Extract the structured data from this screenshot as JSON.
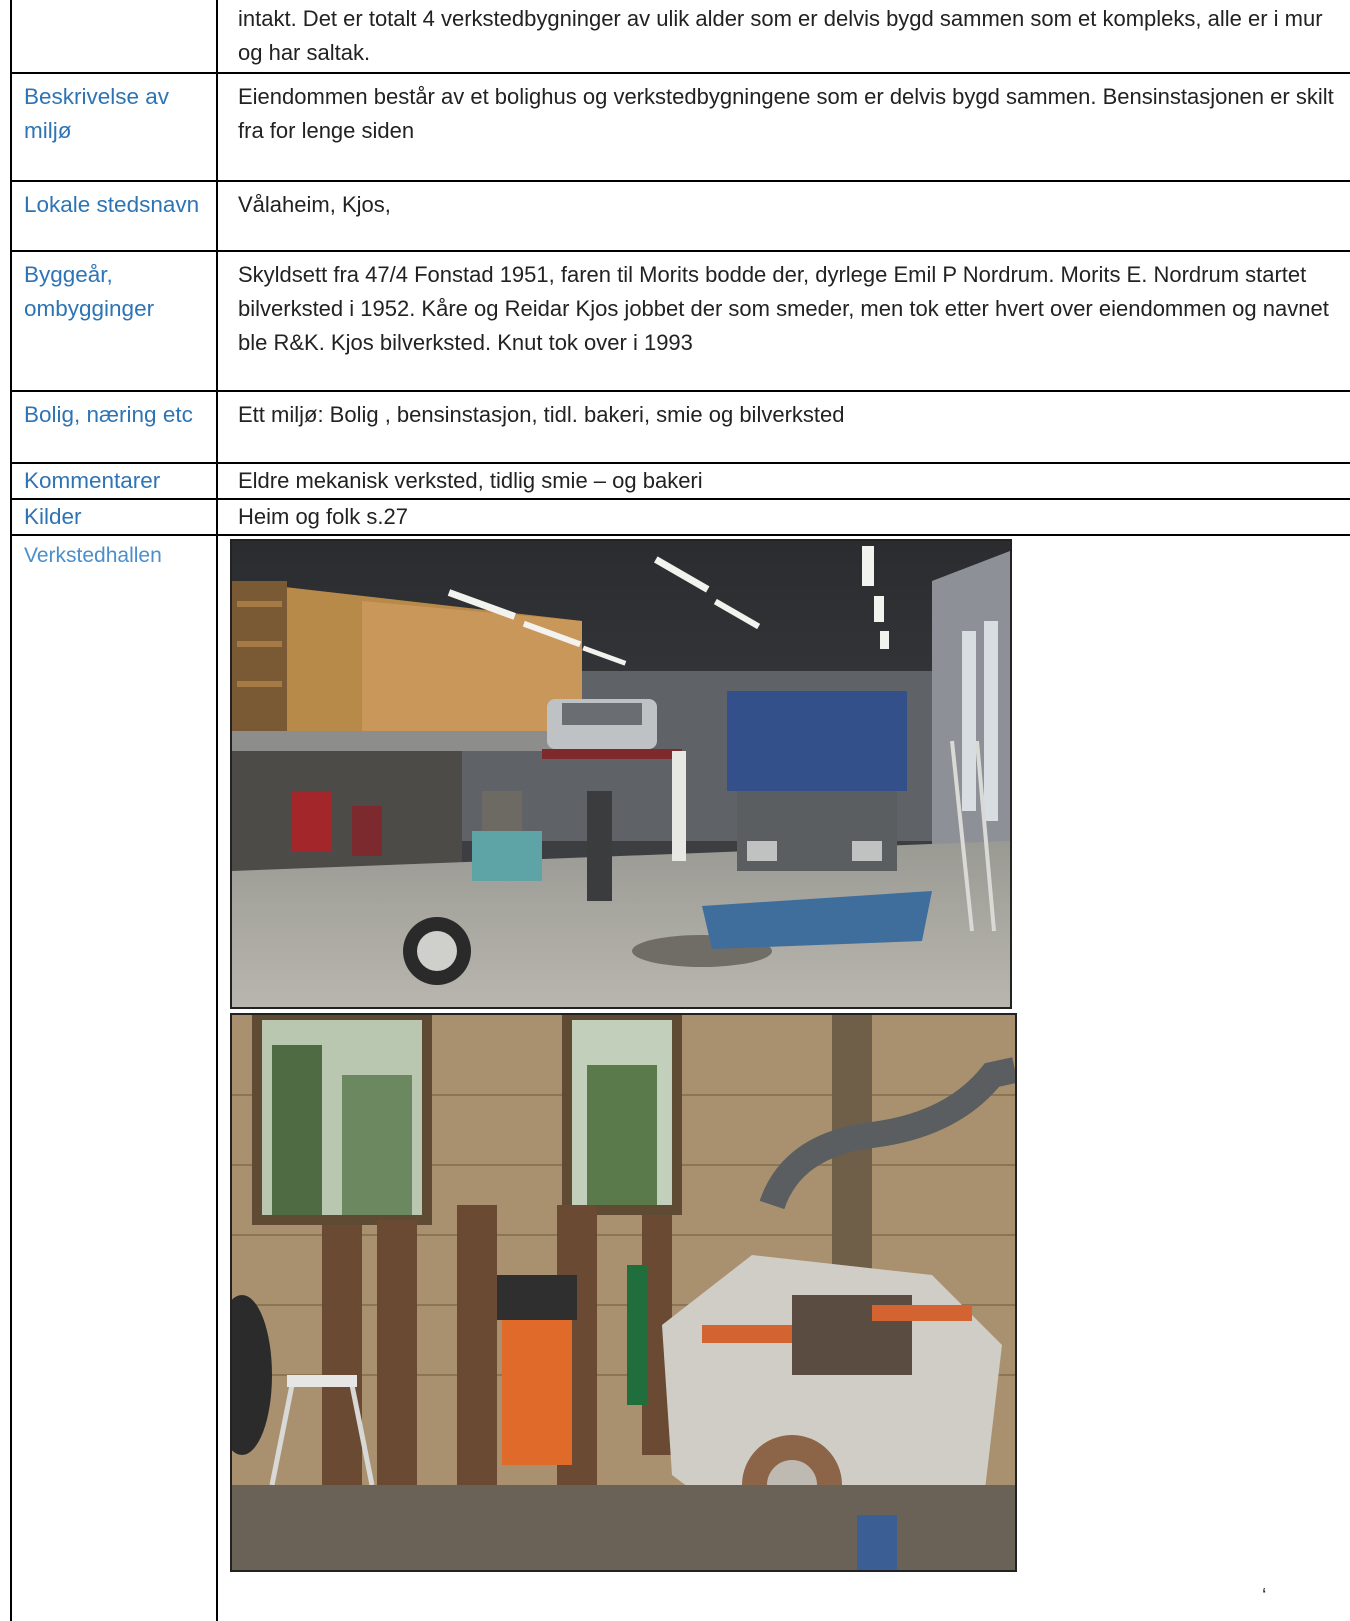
{
  "rows": [
    {
      "label": "",
      "value": "intakt. Det er totalt 4 verkstedbygninger av ulik alder som er delvis bygd sammen som et kompleks, alle er i mur og har saltak."
    },
    {
      "label": "Beskrivelse av miljø",
      "value": "Eiendommen består av et bolighus og verkstedbygningene som er delvis bygd sammen. Bensinstasjonen er skilt fra for lenge siden"
    },
    {
      "label": "Lokale stedsnavn",
      "value": "Vålaheim, Kjos,"
    },
    {
      "label": "Byggeår, ombygginger",
      "value": "Skyldsett fra 47/4 Fonstad 1951, faren til Morits bodde der, dyrlege Emil P Nordrum. Morits E. Nordrum startet bilverksted i 1952. Kåre og Reidar Kjos jobbet der som smeder, men tok etter hvert over eiendommen og navnet ble R&K. Kjos bilverksted. Knut tok over i 1993"
    },
    {
      "label": "Bolig, næring etc",
      "value": "Ett miljø: Bolig , bensinstasjon, tidl. bakeri, smie og bilverksted"
    },
    {
      "label": "Kommentarer",
      "value": "Eldre mekanisk verksted, tidlig smie – og bakeri"
    },
    {
      "label": "Kilder",
      "value": "Heim og folk s.27"
    }
  ],
  "photo_row": {
    "label": "Verkstedhallen"
  },
  "photos": [
    {
      "subject": "workshop hall with lifts, truck and car"
    },
    {
      "subject": "welding equipment and machinery"
    }
  ],
  "corner_mark": "‘"
}
